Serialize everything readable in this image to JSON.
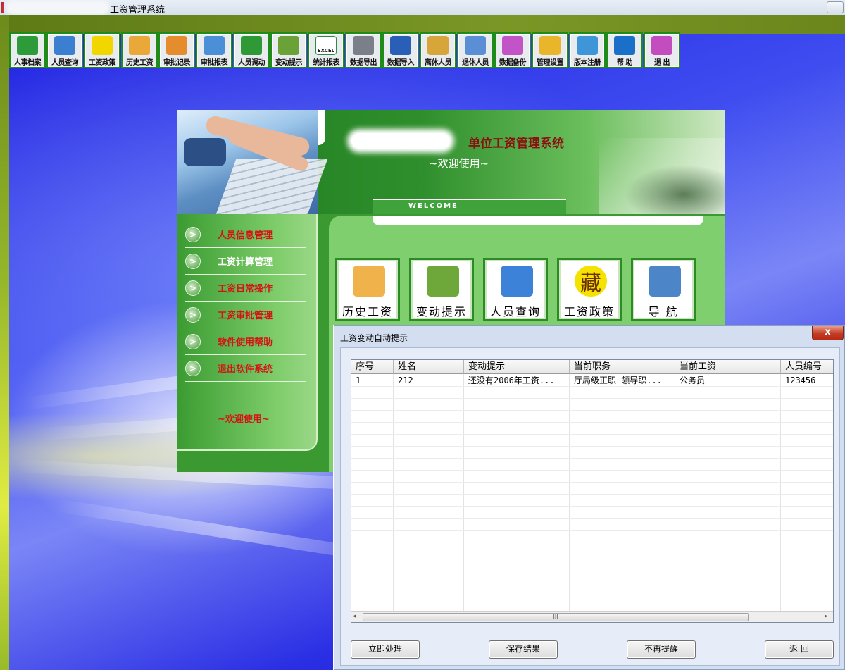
{
  "window": {
    "title": "工资管理系统"
  },
  "toolbar": {
    "items": [
      {
        "label": "人事档案",
        "icon": "people-files-icon",
        "color": "#2e9b3a"
      },
      {
        "label": "人员查询",
        "icon": "magnifier-book-icon",
        "color": "#3a7fd0"
      },
      {
        "label": "工资政策",
        "icon": "seal-character-icon",
        "color": "#f2d600"
      },
      {
        "label": "历史工资",
        "icon": "folder-coins-icon",
        "color": "#e9a838"
      },
      {
        "label": "审批记录",
        "icon": "pencil-document-icon",
        "color": "#e58d2c"
      },
      {
        "label": "审批报表",
        "icon": "report-chart-icon",
        "color": "#4b8fd6"
      },
      {
        "label": "人员调动",
        "icon": "recycle-arrows-icon",
        "color": "#2f9a35"
      },
      {
        "label": "变动提示",
        "icon": "alarm-clock-icon",
        "color": "#6aa238"
      },
      {
        "label": "统计报表",
        "icon": "excel-icon",
        "color": "#2c8a46",
        "caption": "EXCEL"
      },
      {
        "label": "数据导出",
        "icon": "printer-export-icon",
        "color": "#7a7f8a"
      },
      {
        "label": "数据导入",
        "icon": "monitor-import-icon",
        "color": "#2a5fb8"
      },
      {
        "label": "离休人员",
        "icon": "photo-folder-icon",
        "color": "#d8a53a"
      },
      {
        "label": "退休人员",
        "icon": "photo-folder-blue-icon",
        "color": "#5a8fd6"
      },
      {
        "label": "数据备份",
        "icon": "disks-backup-icon",
        "color": "#c254c8"
      },
      {
        "label": "管理设置",
        "icon": "padlock-icon",
        "color": "#e9b52a"
      },
      {
        "label": "版本注册",
        "icon": "register-hand-icon",
        "color": "#3e96d8"
      },
      {
        "label": "帮  助",
        "icon": "help-question-icon",
        "color": "#1a6fc9"
      },
      {
        "label": "退  出",
        "icon": "exit-icon",
        "color": "#c34dbf"
      }
    ]
  },
  "header": {
    "title_suffix": "单位工资管理系统",
    "welcome": "~欢迎使用~",
    "banner": "WELCOME"
  },
  "menu": {
    "items": [
      {
        "label": "人员信息管理",
        "color": "#d41414"
      },
      {
        "label": "工资计算管理",
        "color": "#ffffff"
      },
      {
        "label": "工资日常操作",
        "color": "#d41414"
      },
      {
        "label": "工资审批管理",
        "color": "#d41414"
      },
      {
        "label": "软件使用帮助",
        "color": "#d41414"
      },
      {
        "label": "退出软件系统",
        "color": "#d41414"
      }
    ],
    "footer": "~欢迎使用~"
  },
  "quick_buttons": [
    {
      "label": "历史工资",
      "icon": "folder-coins-icon",
      "color": "#f0b24a"
    },
    {
      "label": "变动提示",
      "icon": "alarm-clock-icon",
      "color": "#6fa83a"
    },
    {
      "label": "人员查询",
      "icon": "magnifier-book-icon",
      "color": "#3b82d8"
    },
    {
      "label": "工资政策",
      "icon": "seal-character-icon",
      "color": "#f4e200",
      "glyph": "藏"
    },
    {
      "label": "导  航",
      "icon": "satellite-icon",
      "color": "#4c86c9"
    }
  ],
  "dialog": {
    "title": "工资变动自动提示",
    "close": "x",
    "columns": [
      "序号",
      "姓名",
      "变动提示",
      "当前职务",
      "当前工资",
      "人员编号"
    ],
    "rows": [
      [
        "1",
        "212",
        "还没有2006年工资...",
        "厅局级正职 领导职...",
        "公务员",
        "123456"
      ]
    ],
    "buttons": [
      "立即处理",
      "保存结果",
      "不再提醒",
      "返   回"
    ],
    "scroll_grip": "III",
    "scroll_left": "◂",
    "scroll_right": "▸"
  }
}
